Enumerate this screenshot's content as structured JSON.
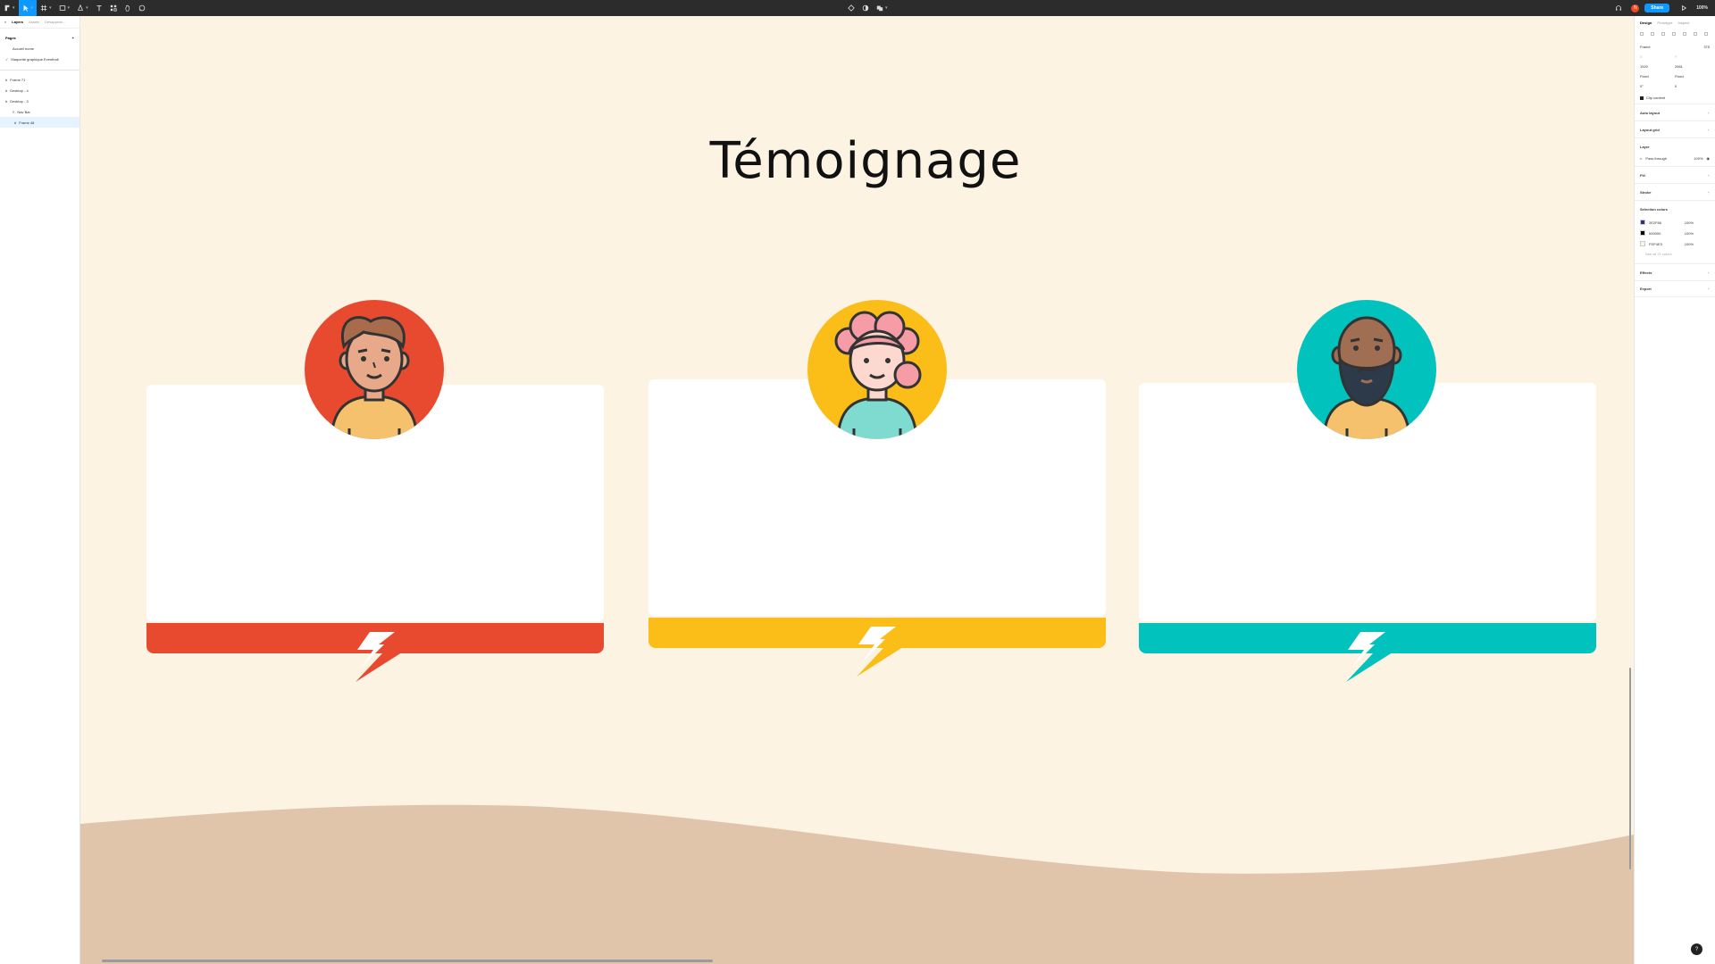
{
  "toolbar": {
    "zoom": "100%",
    "share_label": "Share",
    "collaborator_initial": "N"
  },
  "left_panel": {
    "tabs": [
      "Layers",
      "Assets",
      "Désapprob..."
    ],
    "pages_title": "Pages",
    "pages": [
      "Accueil home",
      "Maquette graphique Eventhall"
    ],
    "layers": [
      {
        "label": "Frame 71",
        "indent": 0,
        "selected": false
      },
      {
        "label": "Desktop - 4",
        "indent": 0,
        "selected": false
      },
      {
        "label": "Desktop - 3",
        "indent": 0,
        "selected": false
      },
      {
        "label": "Nav Bar",
        "indent": 1,
        "selected": false
      },
      {
        "label": "Frame 48",
        "indent": 2,
        "selected": true
      }
    ]
  },
  "canvas": {
    "title": "Témoignage",
    "background": "#fdf3e3",
    "wave_color": "#e0c5ab",
    "cards": [
      {
        "accent": "#e84a30",
        "avatar": "man-brown-hair-avatar"
      },
      {
        "accent": "#fbbd17",
        "avatar": "woman-pink-hair-avatar"
      },
      {
        "accent": "#02c2bd",
        "avatar": "bald-bearded-man-avatar"
      }
    ]
  },
  "right_panel": {
    "tabs": [
      "Design",
      "Prototype",
      "Inspect"
    ],
    "frame_label": "Frame",
    "frame_value": "375",
    "fields": {
      "x_label": "X",
      "x_value": "1920",
      "y_label": "Y",
      "y_value": "2661",
      "w_value": "Fixed",
      "h_value": "Fixed",
      "rotation": "0°",
      "radius": "0"
    },
    "clip_content_label": "Clip content",
    "sections": {
      "auto_layout": "Auto layout",
      "layout_grid": "Layout grid",
      "layer": "Layer",
      "fill": "Fill",
      "stroke": "Stroke",
      "selection_colors": "Selection colors",
      "effects": "Effects",
      "export": "Export"
    },
    "layer_blend": "Pass through",
    "layer_opacity": "100%",
    "selection_colors": [
      {
        "hex": "2E2F86",
        "swatch": "#2e2f86",
        "pct": "100%"
      },
      {
        "hex": "000000",
        "swatch": "#000000",
        "pct": "100%"
      },
      {
        "hex": "FDF4E3",
        "swatch": "#fdf4e3",
        "pct": "100%"
      }
    ],
    "see_all_label": "See all 21 colors"
  },
  "help_label": "?"
}
